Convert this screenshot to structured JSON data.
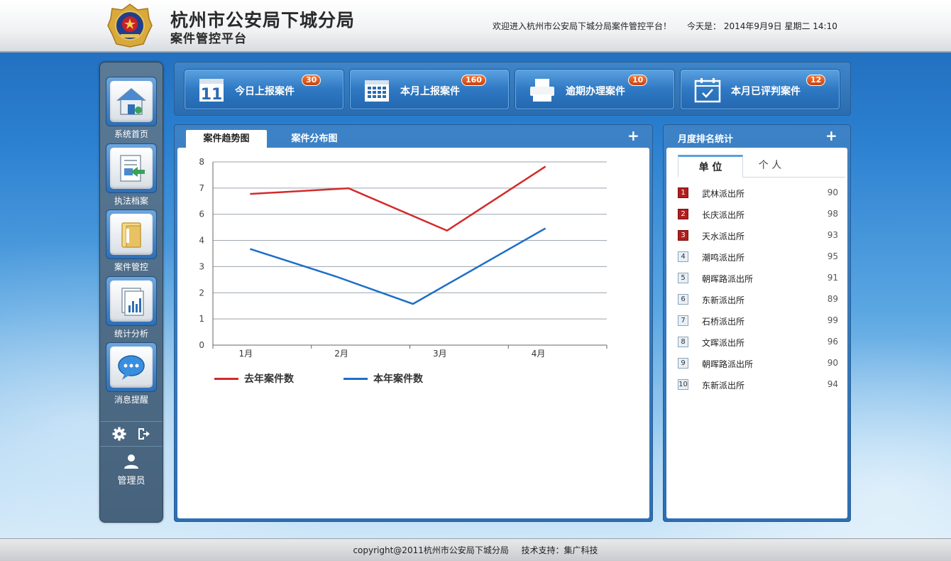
{
  "header": {
    "title": "杭州市公安局下城分局",
    "subtitle": "案件管控平台",
    "welcome": "欢迎进入杭州市公安局下城分局案件管控平台！",
    "today": "今天是： 2014年9月9日 星期二  14:10"
  },
  "sidebar": {
    "items": [
      {
        "label": "系统首页",
        "icon": "home-icon"
      },
      {
        "label": "执法档案",
        "icon": "archive-icon"
      },
      {
        "label": "案件管控",
        "icon": "folder-icon"
      },
      {
        "label": "统计分析",
        "icon": "stats-icon"
      },
      {
        "label": "消息提醒",
        "icon": "message-icon"
      }
    ],
    "user": "管理员"
  },
  "stats": [
    {
      "label": "今日上报案件",
      "count": "30",
      "icon": "calendar-day-icon"
    },
    {
      "label": "本月上报案件",
      "count": "160",
      "icon": "calendar-month-icon"
    },
    {
      "label": "逾期办理案件",
      "count": "10",
      "icon": "printer-icon"
    },
    {
      "label": "本月已评判案件",
      "count": "12",
      "icon": "calendar-check-icon"
    }
  ],
  "chart_panel": {
    "tabs": [
      "案件趋势图",
      "案件分布图"
    ],
    "plus": "+"
  },
  "rank_panel": {
    "title": "月度排名统计",
    "plus": "+",
    "tabs": [
      "单 位",
      "个 人"
    ],
    "rows": [
      {
        "rank": "1",
        "name": "武林派出所",
        "score": "90"
      },
      {
        "rank": "2",
        "name": "长庆派出所",
        "score": "98"
      },
      {
        "rank": "3",
        "name": "天水派出所",
        "score": "93"
      },
      {
        "rank": "4",
        "name": "潮鸣派出所",
        "score": "95"
      },
      {
        "rank": "5",
        "name": "朝晖路派出所",
        "score": "91"
      },
      {
        "rank": "6",
        "name": "东新派出所",
        "score": "89"
      },
      {
        "rank": "7",
        "name": "石桥派出所",
        "score": "99"
      },
      {
        "rank": "8",
        "name": "文晖派出所",
        "score": "96"
      },
      {
        "rank": "9",
        "name": "朝晖路派出所",
        "score": "90"
      },
      {
        "rank": "10",
        "name": "东新派出所",
        "score": "94"
      }
    ]
  },
  "chart_data": {
    "type": "line",
    "categories": [
      "1月",
      "2月",
      "3月",
      "4月"
    ],
    "yticks": [
      "0",
      "1",
      "2",
      "3",
      "4",
      "6",
      "7",
      "8"
    ],
    "series": [
      {
        "name": "去年案件数",
        "color": "#d42a2a",
        "values": [
          6.6,
          6.85,
          5.0,
          7.8
        ]
      },
      {
        "name": "本年案件数",
        "color": "#1c6fc8",
        "values": [
          4.2,
          3.0,
          1.8,
          5.1
        ]
      }
    ],
    "ylim": [
      0,
      8
    ],
    "grid": true,
    "legend": "bottom-left"
  },
  "footer": {
    "copyright": "copyright@2011杭州市公安局下城分局",
    "support": "技术支持：集广科技"
  }
}
